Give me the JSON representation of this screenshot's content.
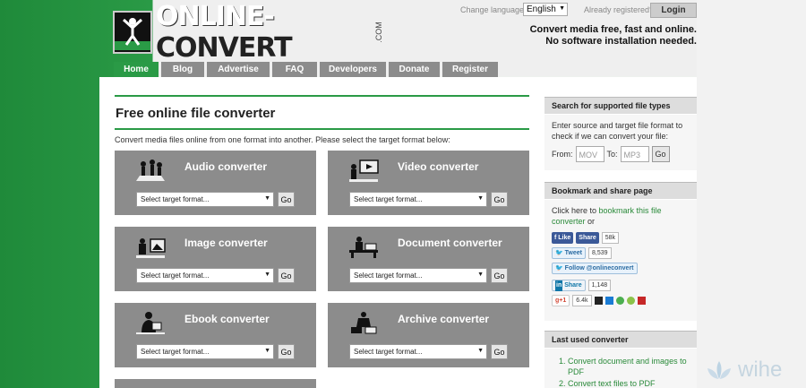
{
  "header": {
    "logo_text_a": "ONLINE-",
    "logo_text_b": "CONVERT",
    "logo_com": ".COM",
    "change_language_label": "Change language:",
    "language": "English",
    "already_registered": "Already registered?",
    "login_label": "Login",
    "tagline_line1": "Convert media free, fast and online.",
    "tagline_line2": "No software installation needed."
  },
  "nav": [
    {
      "label": "Home"
    },
    {
      "label": "Blog"
    },
    {
      "label": "Advertise"
    },
    {
      "label": "FAQ"
    },
    {
      "label": "Developers"
    },
    {
      "label": "Donate"
    },
    {
      "label": "Register"
    }
  ],
  "main": {
    "title": "Free online file converter",
    "intro": "Convert media files online from one format into another. Please select the target format below:",
    "select_placeholder": "Select target format...",
    "go_label": "Go",
    "converters": [
      {
        "title": "Audio converter",
        "icon": "audio-icon"
      },
      {
        "title": "Video converter",
        "icon": "video-icon"
      },
      {
        "title": "Image converter",
        "icon": "image-icon"
      },
      {
        "title": "Document converter",
        "icon": "document-icon"
      },
      {
        "title": "Ebook converter",
        "icon": "ebook-icon"
      },
      {
        "title": "Archive converter",
        "icon": "archive-icon"
      }
    ]
  },
  "sidebar": {
    "search": {
      "title": "Search for supported file types",
      "desc": "Enter source and target file format to check if we can convert your file:",
      "from_label": "From:",
      "from_placeholder": "MOV",
      "to_label": "To:",
      "to_placeholder": "MP3",
      "go_label": "Go"
    },
    "bookmark": {
      "title": "Bookmark and share page",
      "desc_a": "Click here to ",
      "link": "bookmark this file converter",
      "desc_b": " or",
      "like": "Like",
      "share": "Share",
      "fb_count": "58k",
      "tweet": "Tweet",
      "tweet_count": "8,539",
      "follow": "Follow @onlineconvert",
      "li_share": "Share",
      "li_count": "1,148",
      "gplus": "+1",
      "gplus_count": "6.4k"
    },
    "last_used": {
      "title": "Last used converter",
      "items": [
        "Convert document and images to PDF",
        "Convert text files to PDF"
      ]
    }
  },
  "watermark": "wihe",
  "colors": {
    "brand_green": "#2a9a46",
    "card_gray": "#8c8c8c",
    "link_green": "#2a8a3a"
  }
}
